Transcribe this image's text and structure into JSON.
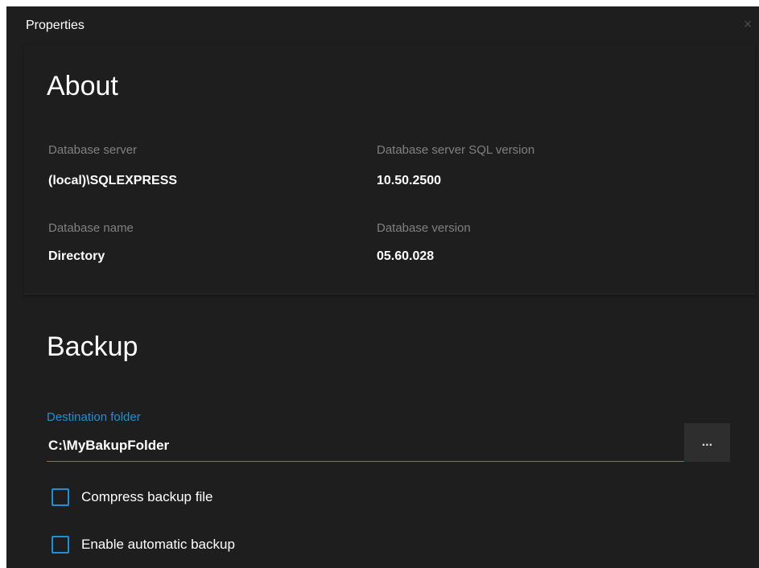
{
  "window": {
    "title": "Properties",
    "close_glyph": "×"
  },
  "about": {
    "heading": "About",
    "fields": {
      "database_server": {
        "label": "Database server",
        "value": "(local)\\SQLEXPRESS"
      },
      "sql_version": {
        "label": "Database server SQL version",
        "value": "10.50.2500"
      },
      "database_name": {
        "label": "Database name",
        "value": "Directory"
      },
      "database_version": {
        "label": "Database version",
        "value": "05.60.028"
      }
    }
  },
  "backup": {
    "heading": "Backup",
    "destination_label": "Destination folder",
    "destination_value": "C:\\MyBakupFolder",
    "browse_label": "...",
    "compress": {
      "label": "Compress backup file",
      "checked": false
    },
    "automatic": {
      "label": "Enable automatic backup",
      "checked": false
    }
  },
  "colors": {
    "background": "#1e1e1e",
    "accent": "#1e90d6",
    "label_gray": "#808080",
    "text": "#ffffff"
  },
  "icons": {
    "close": "close-icon",
    "compress_checkbox": "checkbox-icon",
    "automatic_checkbox": "checkbox-icon"
  }
}
